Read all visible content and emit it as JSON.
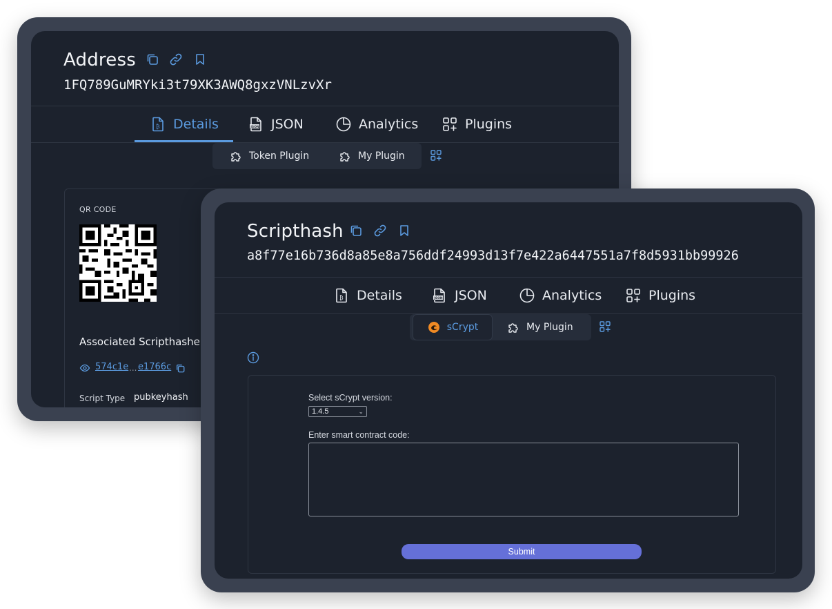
{
  "address_panel": {
    "title": "Address",
    "value": "1FQ789GuMRYki3t79XK3AWQ8gxzVNLzvXr",
    "tabs": [
      {
        "label": "Details",
        "icon": "bitcoin-file-icon",
        "active": true
      },
      {
        "label": "JSON",
        "icon": "json-file-icon",
        "active": false
      },
      {
        "label": "Analytics",
        "icon": "pie-chart-icon",
        "active": false
      },
      {
        "label": "Plugins",
        "icon": "grid-plus-icon",
        "active": false
      }
    ],
    "plugin_tabs": [
      {
        "label": "Token Plugin",
        "icon": "puzzle-icon"
      },
      {
        "label": "My Plugin",
        "icon": "puzzle-icon"
      }
    ],
    "qr_label": "QR CODE",
    "associated_heading": "Associated Scripthashe",
    "scripthash_start": "574c1e",
    "scripthash_ellipsis": "...",
    "scripthash_end": "e1766c",
    "script_type_label": "Script Type",
    "script_type_value": "pubkeyhash"
  },
  "scripthash_panel": {
    "title": "Scripthash",
    "value": "a8f77e16b736d8a85e8a756ddf24993d13f7e422a6447551a7f8d5931bb99926",
    "tabs": [
      {
        "label": "Details",
        "icon": "bitcoin-file-icon",
        "active": false
      },
      {
        "label": "JSON",
        "icon": "json-file-icon",
        "active": false
      },
      {
        "label": "Analytics",
        "icon": "pie-chart-icon",
        "active": false
      },
      {
        "label": "Plugins",
        "icon": "grid-plus-icon",
        "active": false
      }
    ],
    "plugin_tabs": [
      {
        "label": "sCrypt",
        "icon": "scrypt-logo-icon",
        "active": true
      },
      {
        "label": "My Plugin",
        "icon": "puzzle-icon",
        "active": false
      }
    ],
    "form": {
      "version_label": "Select sCrypt version:",
      "version_selected": "1.4.5",
      "code_label": "Enter smart contract code:",
      "code_value": "",
      "submit_label": "Submit"
    }
  },
  "colors": {
    "frame": "#3a4150",
    "screen": "#1c222d",
    "accent": "#5b9be0",
    "submit": "#6570d8"
  }
}
